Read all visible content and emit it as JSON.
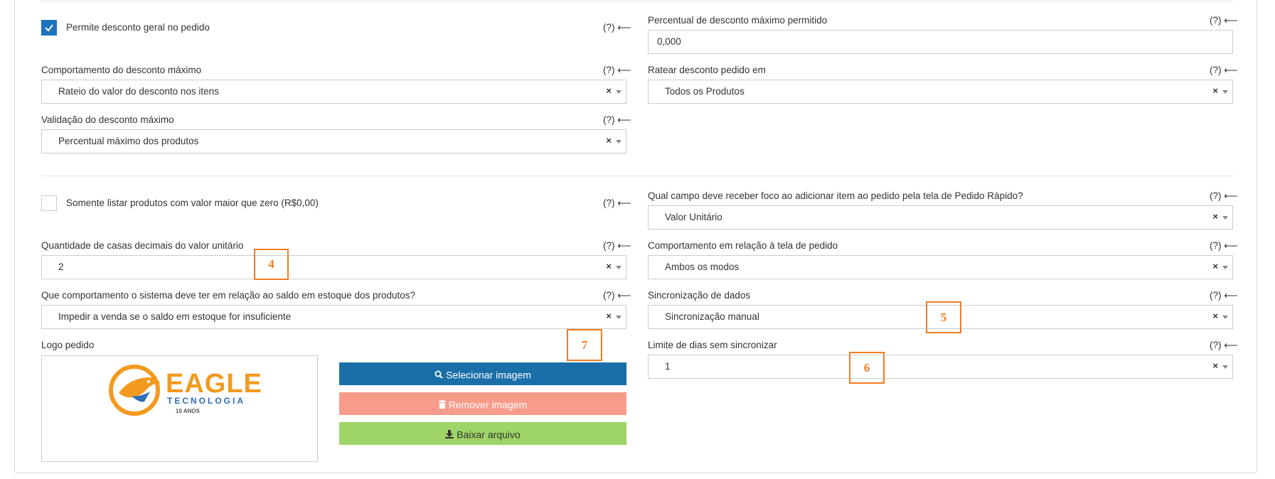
{
  "help_text": "(?) ⟵",
  "left": {
    "desconto_geral": {
      "label": "Permite desconto geral no pedido",
      "checked": true
    },
    "comportamento_desconto": {
      "label": "Comportamento do desconto máximo",
      "value": "Rateio do valor do desconto nos itens"
    },
    "validacao_desconto": {
      "label": "Validação do desconto máximo",
      "value": "Percentual máximo dos produtos"
    },
    "somente_listar": {
      "label": "Somente listar produtos com valor maior que zero (R$0,00)",
      "checked": false
    },
    "casas_decimais": {
      "label": "Quantidade de casas decimais do valor unitário",
      "value": "2"
    },
    "comportamento_estoque": {
      "label": "Que comportamento o sistema deve ter em relação ao saldo em estoque dos produtos?",
      "value": "Impedir a venda se o saldo em estoque for insuficiente"
    },
    "logo": {
      "label": "Logo pedido",
      "brand": "EAGLE",
      "brand_sub": "TECNOLOGIA",
      "badge": "10 ANOS",
      "select_label": "Selecionar imagem",
      "remove_label": "Remover imagem",
      "download_label": "Baixar arquivo"
    }
  },
  "right": {
    "percentual_desconto": {
      "label": "Percentual de desconto máximo permitido",
      "value": "0,000"
    },
    "ratear_desconto": {
      "label": "Ratear desconto pedido em",
      "value": "Todos os Produtos"
    },
    "campo_foco": {
      "label": "Qual campo deve receber foco ao adicionar item ao pedido pela tela de Pedido Rápido?",
      "value": "Valor Unitário"
    },
    "comportamento_tela": {
      "label": "Comportamento em relação à tela de pedido",
      "value": "Ambos os modos"
    },
    "sincronizacao": {
      "label": "Sincronização de dados",
      "value": "Sincronização manual"
    },
    "limite_dias": {
      "label": "Limite de dias sem sincronizar",
      "value": "1"
    }
  },
  "clear_glyph": "×",
  "annotations": [
    "4",
    "5",
    "6",
    "7"
  ],
  "colors": {
    "primary": "#1e73be",
    "select_button": "#1a6fa8",
    "remove_button": "#f99b8a",
    "download_button": "#9fd466",
    "annotation": "#f47c20",
    "logo_orange": "#f39a1e",
    "logo_blue": "#2d6db5"
  },
  "icons": {
    "select": "search-icon",
    "remove": "trash-icon",
    "download": "download-icon"
  }
}
